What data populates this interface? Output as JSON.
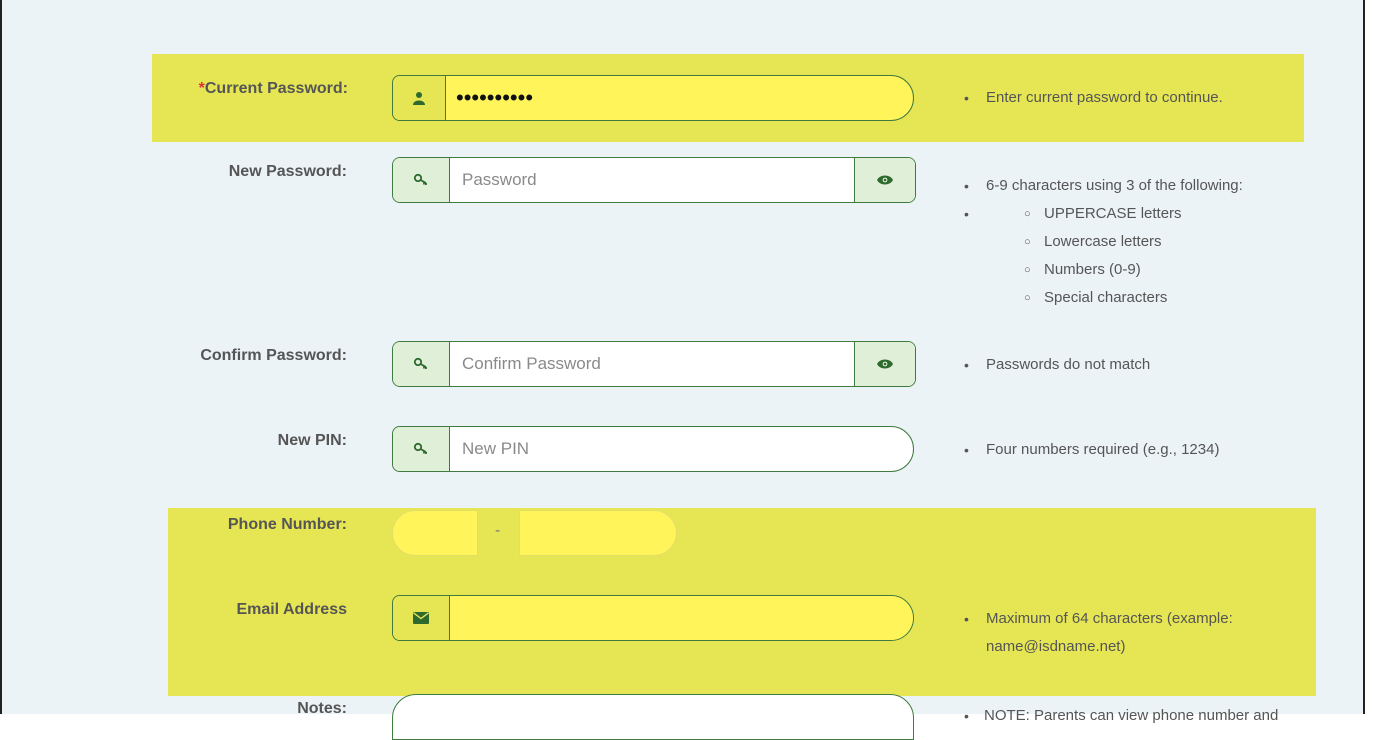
{
  "current_password": {
    "required_mark": "*",
    "label": "Current Password:",
    "value": "••••••••••",
    "hint": "Enter current password to continue.",
    "icon": "user-icon"
  },
  "new_password": {
    "label": "New Password:",
    "placeholder": "Password",
    "icon": "key-icon",
    "toggle_icon": "eye-icon",
    "hint": "6-9 characters using 3 of the following:",
    "rules": [
      "UPPERCASE letters",
      "Lowercase letters",
      "Numbers (0-9)",
      "Special characters"
    ]
  },
  "confirm_password": {
    "label": "Confirm Password:",
    "placeholder": "Confirm Password",
    "icon": "key-icon",
    "toggle_icon": "eye-icon",
    "hint": "Passwords do not match"
  },
  "new_pin": {
    "label": "New PIN:",
    "placeholder": "New PIN",
    "icon": "key-icon",
    "hint": "Four numbers required (e.g., 1234)"
  },
  "phone": {
    "label": "Phone Number:",
    "separator": "-"
  },
  "email": {
    "label": "Email Address",
    "icon": "envelope-icon",
    "hint_line1": "Maximum of 64 characters (example:",
    "hint_line2": "name@isdname.net)"
  },
  "notes": {
    "label": "Notes:",
    "hint": "NOTE: Parents can view phone number and"
  },
  "colors": {
    "highlight": "#e6e655",
    "field_yellow": "#fff45a",
    "accent_green": "#3f7a3f",
    "addon_green": "#e0f0d8",
    "panel_bg": "#ecf3f7"
  }
}
